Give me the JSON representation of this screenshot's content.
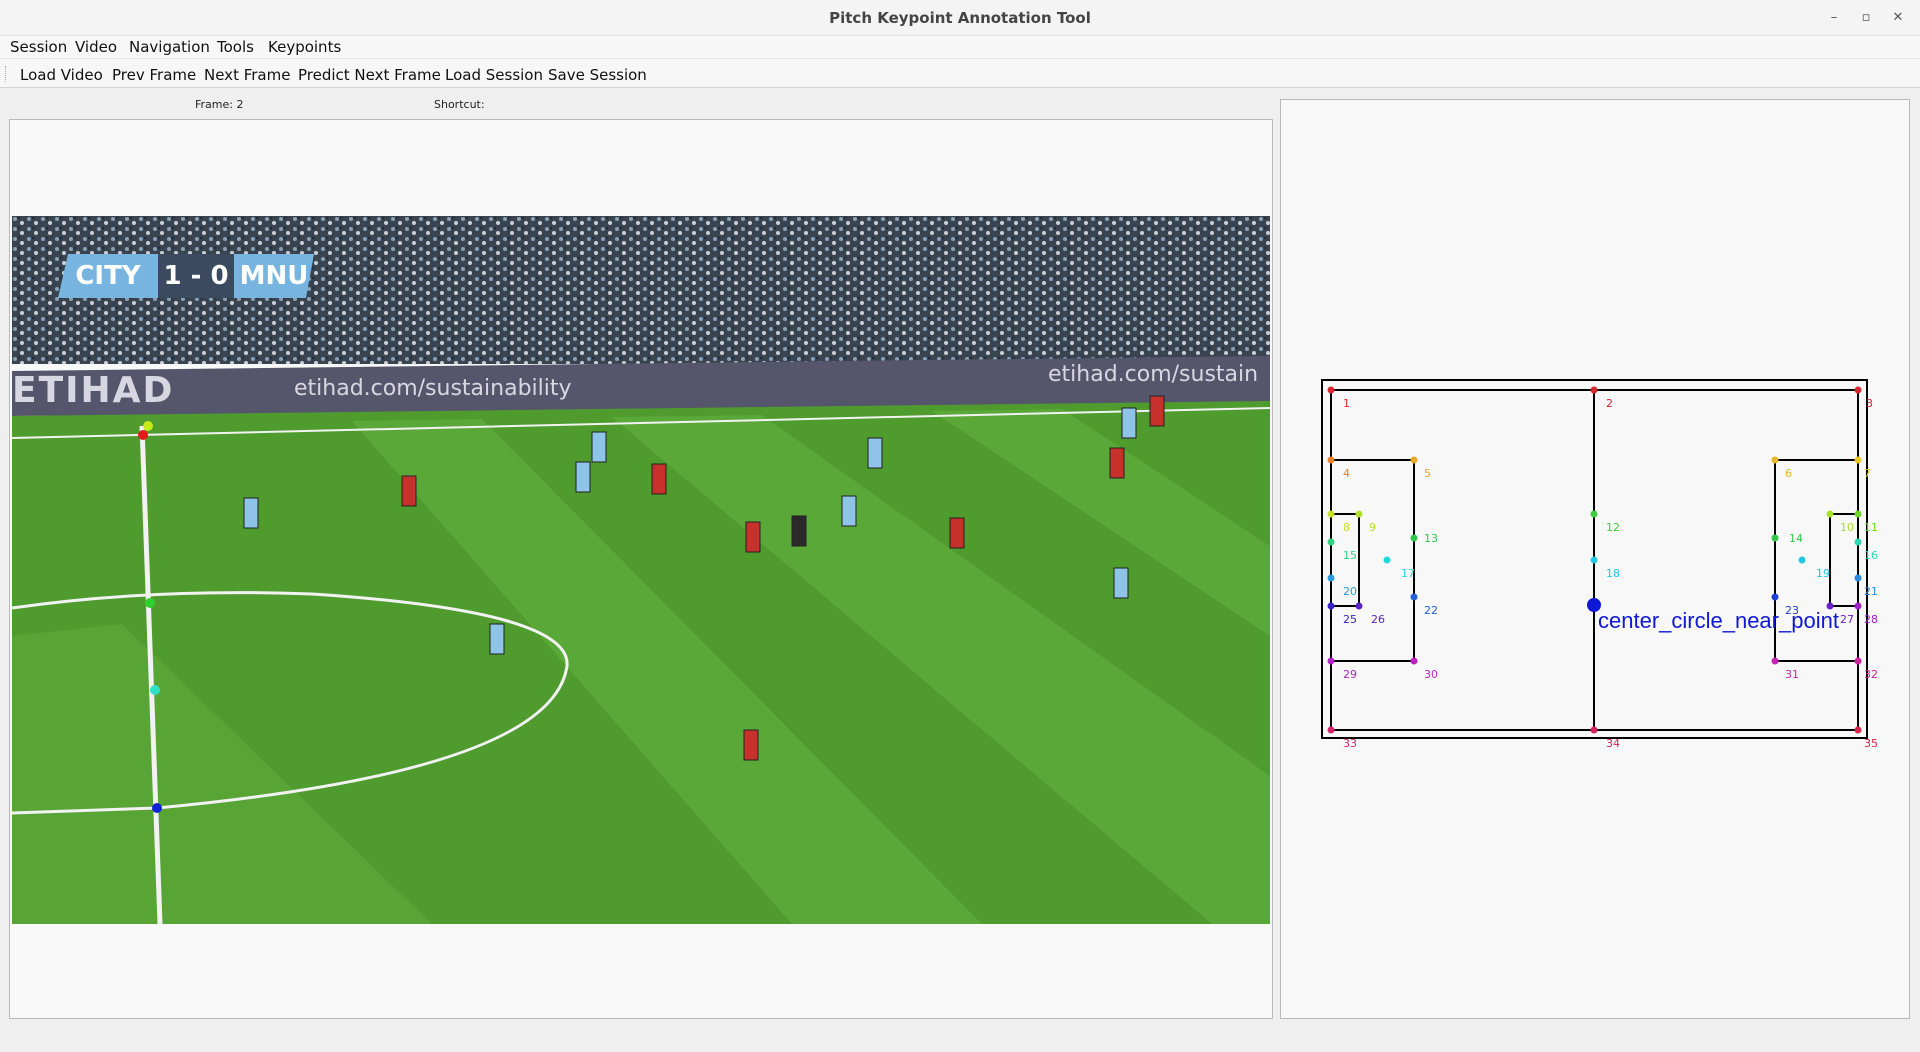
{
  "window": {
    "title": "Pitch Keypoint Annotation Tool",
    "min": "–",
    "max": "▫",
    "close": "✕"
  },
  "menu": [
    "Session",
    "Video",
    "Navigation",
    "Tools",
    "Keypoints"
  ],
  "toolbar": [
    "Load Video",
    "Prev Frame",
    "Next Frame",
    "Predict Next Frame",
    "Load Session",
    "Save Session"
  ],
  "info": {
    "frame_label": "Frame: 2",
    "shortcut_label": "Shortcut:"
  },
  "video": {
    "score_home": "CITY",
    "score": "1 - 0",
    "score_away": "MNU",
    "ads": [
      "ETIHAD",
      "etihad.com/sustainability",
      "etihad.com/sustain"
    ],
    "colors": {
      "pitch": "#4f9b2e",
      "pitch_dark": "#3f8a22",
      "crowd": "#3c4754",
      "board": "#56576e",
      "home_kit": "#8fc3e8",
      "away_kit": "#c8302c"
    },
    "keypoint_markers": [
      {
        "id": 1,
        "color": "#e21a1a"
      },
      {
        "id": 4,
        "color": "#c6e91a"
      },
      {
        "id": 12,
        "color": "#2fd12f"
      },
      {
        "id": 16,
        "color": "#2fe0c8"
      },
      {
        "id": 18,
        "color": "#1022d8"
      }
    ]
  },
  "pitch_template": {
    "selected_label": "center_circle_near_point",
    "points": [
      {
        "label": "1",
        "color": "#d8262e"
      },
      {
        "label": "2",
        "color": "#d8262e"
      },
      {
        "label": "3",
        "color": "#d8262e"
      },
      {
        "label": "4",
        "color": "#e8802a"
      },
      {
        "label": "5",
        "color": "#e8a62a"
      },
      {
        "label": "6",
        "color": "#e8b82a"
      },
      {
        "label": "7",
        "color": "#e8c82a"
      },
      {
        "label": "8",
        "color": "#c8e02a"
      },
      {
        "label": "9",
        "color": "#b0e02a"
      },
      {
        "label": "10",
        "color": "#a8e02a"
      },
      {
        "label": "11",
        "color": "#6ad82a"
      },
      {
        "label": "12",
        "color": "#3ccc3c"
      },
      {
        "label": "13",
        "color": "#2fc64a"
      },
      {
        "label": "14",
        "color": "#2fc64a"
      },
      {
        "label": "15",
        "color": "#2fd080"
      },
      {
        "label": "16",
        "color": "#2fd8b0"
      },
      {
        "label": "17",
        "color": "#22d8d8"
      },
      {
        "label": "18",
        "color": "#22c8e0"
      },
      {
        "label": "19",
        "color": "#22c8e0"
      },
      {
        "label": "20",
        "color": "#2a9ae0"
      },
      {
        "label": "21",
        "color": "#2a8ae0"
      },
      {
        "label": "22",
        "color": "#2260d8"
      },
      {
        "label": "23",
        "color": "#2240d0"
      },
      {
        "label": "25",
        "color": "#3a22c8"
      },
      {
        "label": "26",
        "color": "#5a22c8"
      },
      {
        "label": "27",
        "color": "#6a22c8"
      },
      {
        "label": "28",
        "color": "#9a22c8"
      },
      {
        "label": "29",
        "color": "#b022c8"
      },
      {
        "label": "30",
        "color": "#c022c0"
      },
      {
        "label": "31",
        "color": "#c822b0"
      },
      {
        "label": "32",
        "color": "#d0229a"
      },
      {
        "label": "33",
        "color": "#d82270"
      },
      {
        "label": "34",
        "color": "#d82260"
      },
      {
        "label": "35",
        "color": "#d8224a"
      }
    ],
    "colors": {
      "line": "#000000",
      "selected": "#1018d8"
    }
  }
}
